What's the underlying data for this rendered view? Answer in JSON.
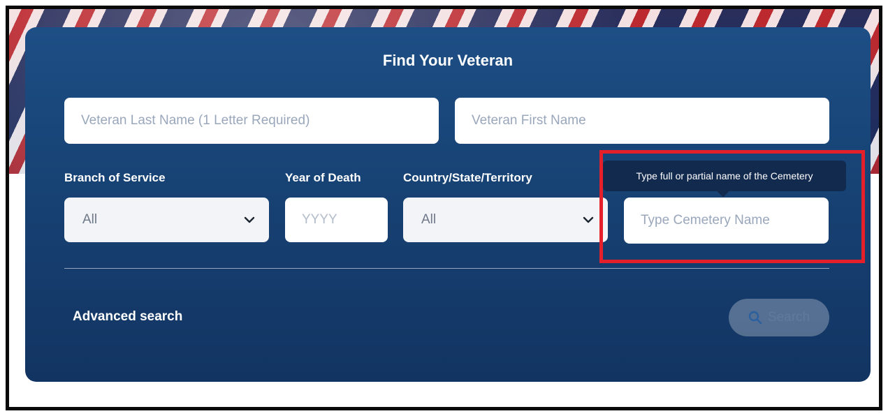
{
  "form": {
    "title": "Find Your Veteran",
    "last_name_placeholder": "Veteran Last Name (1 Letter Required)",
    "first_name_placeholder": "Veteran First Name",
    "branch": {
      "label": "Branch of Service",
      "value": "All"
    },
    "year": {
      "label": "Year of Death",
      "placeholder": "YYYY"
    },
    "country": {
      "label": "Country/State/Territory",
      "value": "All"
    },
    "cemetery": {
      "placeholder": "Type Cemetery Name",
      "tooltip": "Type full or partial name of the Cemetery"
    },
    "advanced_search_label": "Advanced search",
    "search_label": "Search"
  },
  "colors": {
    "panel": "#174274",
    "highlight": "#e5202a"
  },
  "icons": [
    "chevron-down-icon",
    "search-icon"
  ]
}
